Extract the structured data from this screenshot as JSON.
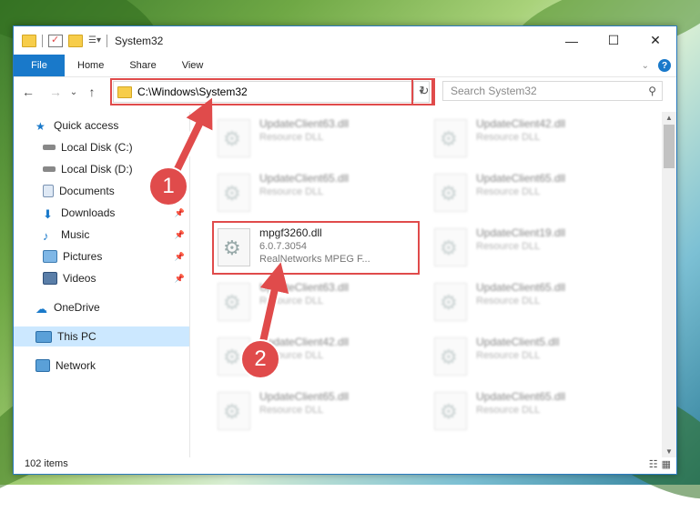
{
  "window": {
    "title": "System32"
  },
  "ribbon": {
    "tabs": [
      "File",
      "Home",
      "Share",
      "View"
    ],
    "help_icon": "?"
  },
  "nav": {
    "back_icon": "←",
    "forward_icon": "→",
    "recent_icon": "⌄",
    "up_icon": "↑",
    "address": "C:\\Windows\\System32",
    "search_placeholder": "Search System32"
  },
  "sidebar": {
    "items": [
      {
        "label": "Quick access",
        "pinned": false
      },
      {
        "label": "Local Disk (C:)",
        "pinned": false
      },
      {
        "label": "Local Disk (D:)",
        "pinned": false
      },
      {
        "label": "Documents",
        "pinned": true
      },
      {
        "label": "Downloads",
        "pinned": true
      },
      {
        "label": "Music",
        "pinned": true
      },
      {
        "label": "Pictures",
        "pinned": true
      },
      {
        "label": "Videos",
        "pinned": true
      },
      {
        "label": "OneDrive",
        "pinned": false
      },
      {
        "label": "This PC",
        "pinned": false
      },
      {
        "label": "Network",
        "pinned": false
      }
    ]
  },
  "files": {
    "selected": {
      "name": "mpgf3260.dll",
      "version": "6.0.7.3054",
      "description": "RealNetworks MPEG F..."
    },
    "left_col": [
      {
        "name": "UpdateClient63.dll",
        "sub": "Resource DLL"
      },
      {
        "name": "UpdateClient65.dll",
        "sub": "Resource DLL"
      },
      {
        "name": "UpdateClient63.dll",
        "sub": "Resource DLL"
      },
      {
        "name": "UpdateClient42.dll",
        "sub": "Resource DLL"
      },
      {
        "name": "UpdateClient65.dll",
        "sub": "Resource DLL"
      }
    ],
    "right_col": [
      {
        "name": "UpdateClient42.dll",
        "sub": "Resource DLL"
      },
      {
        "name": "UpdateClient65.dll",
        "sub": "Resource DLL"
      },
      {
        "name": "UpdateClient19.dll",
        "sub": "Resource DLL"
      },
      {
        "name": "UpdateClient65.dll",
        "sub": "Resource DLL"
      },
      {
        "name": "UpdateClient5.dll",
        "sub": "Resource DLL"
      },
      {
        "name": "UpdateClient65.dll",
        "sub": "Resource DLL"
      }
    ]
  },
  "status": {
    "items_count": "102 items"
  },
  "callouts": [
    "1",
    "2"
  ],
  "colors": {
    "accent": "#1979ca",
    "highlight": "#e04b4b"
  }
}
